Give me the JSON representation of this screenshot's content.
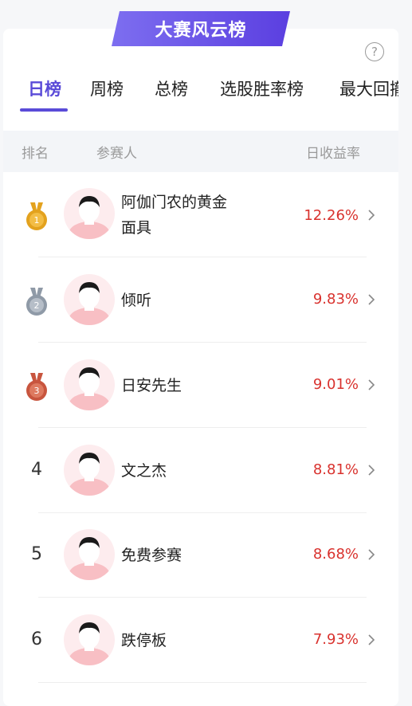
{
  "banner": {
    "title": "大赛风云榜"
  },
  "help_icon": "question-circle-icon",
  "tabs": [
    {
      "label": "日榜",
      "active": true
    },
    {
      "label": "周榜",
      "active": false
    },
    {
      "label": "总榜",
      "active": false
    },
    {
      "label": "选股胜率榜",
      "active": false
    },
    {
      "label": "最大回撤",
      "active": false
    }
  ],
  "table_header": {
    "rank": "排名",
    "participant": "参赛人",
    "return": "日收益率"
  },
  "rows": [
    {
      "rank": "1",
      "medal": "gold",
      "name": "阿伽门农的黄金面具",
      "rate": "12.26%"
    },
    {
      "rank": "2",
      "medal": "silver",
      "name": "倾听",
      "rate": "9.83%"
    },
    {
      "rank": "3",
      "medal": "bronze",
      "name": "日安先生",
      "rate": "9.01%"
    },
    {
      "rank": "4",
      "medal": "",
      "name": "文之杰",
      "rate": "8.81%"
    },
    {
      "rank": "5",
      "medal": "",
      "name": "免费参赛",
      "rate": "8.68%"
    },
    {
      "rank": "6",
      "medal": "",
      "name": "跌停板",
      "rate": "7.93%"
    }
  ],
  "colors": {
    "accent": "#5a4bd8",
    "positive": "#d9322e",
    "gold": "#e3a21e",
    "silver": "#8f9aa7",
    "bronze": "#c8553e"
  }
}
